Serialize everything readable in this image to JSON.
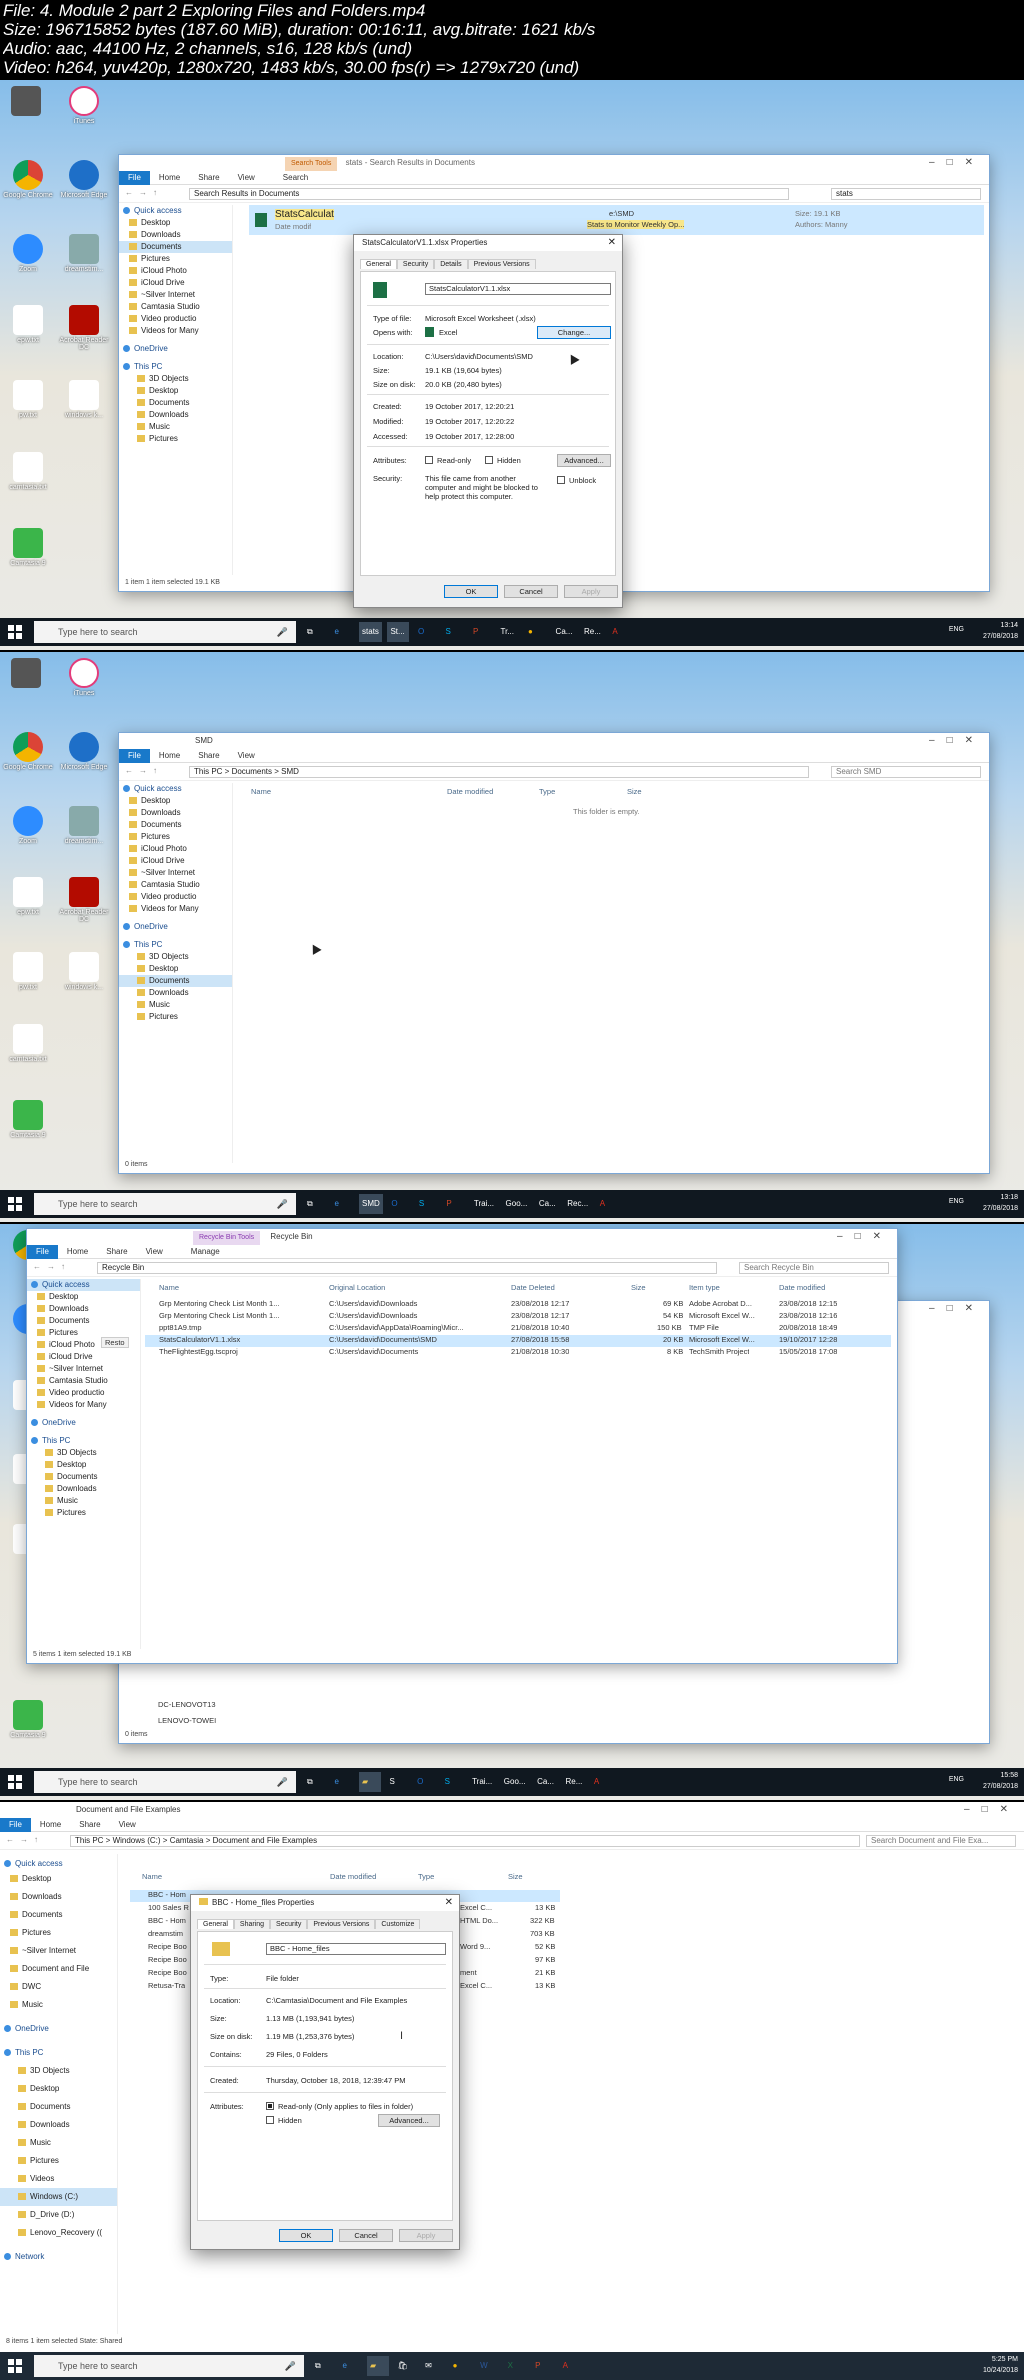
{
  "header": {
    "line1": "File: 4. Module 2 part 2 Exploring Files and Folders.mp4",
    "line2": "Size: 196715852 bytes (187.60 MiB), duration: 00:16:11, avg.bitrate: 1621 kb/s",
    "line3": "Audio: aac, 44100 Hz, 2 channels, s16, 128 kb/s (und)",
    "line4": "Video: h264, yuv420p, 1280x720, 1483 kb/s, 30.00 fps(r) => 1279x720 (und)"
  },
  "desktop_icons": [
    "iTunes",
    "Google Chrome",
    "Microsoft Edge",
    "Zoom",
    "dreamstim...",
    "epw.txt",
    "Acrobat Reader DC",
    "pw.txt",
    "windows k...",
    "camtasia.txt",
    "Camtasia 9"
  ],
  "frame1": {
    "window_title": "stats - Search Results in Documents",
    "ctx_tab": "Search Tools",
    "ribbon": [
      "File",
      "Home",
      "Share",
      "View",
      "Search"
    ],
    "address": "Search Results in Documents",
    "search_value": "stats",
    "nav": [
      {
        "label": "Quick access",
        "type": "head"
      },
      {
        "label": "Desktop"
      },
      {
        "label": "Downloads"
      },
      {
        "label": "Documents",
        "sel": true
      },
      {
        "label": "Pictures"
      },
      {
        "label": "iCloud Photo"
      },
      {
        "label": "iCloud Drive"
      },
      {
        "label": "~Silver Internet"
      },
      {
        "label": "Camtasia Studio"
      },
      {
        "label": "Video productio"
      },
      {
        "label": "Videos for Many"
      },
      {
        "label": "OneDrive",
        "type": "head"
      },
      {
        "label": "This PC",
        "type": "head"
      },
      {
        "label": "3D Objects"
      },
      {
        "label": "Desktop"
      },
      {
        "label": "Documents"
      },
      {
        "label": "Downloads"
      },
      {
        "label": "Music"
      },
      {
        "label": "Pictures"
      }
    ],
    "result_name": "StatsCalculat",
    "result_sub": "Date modif",
    "result_right1": "e:\\SMD",
    "result_right2": "Stats to Monitor Weekly Op...",
    "result_size": "Size: 19.1 KB",
    "result_authors": "Authors: Manny",
    "status": "1 item    1 item selected  19.1 KB",
    "dialog": {
      "title": "StatsCalculatorV1.1.xlsx Properties",
      "tabs": [
        "General",
        "Security",
        "Details",
        "Previous Versions"
      ],
      "filename": "StatsCalculatorV1.1.xlsx",
      "type_label": "Type of file:",
      "type_value": "Microsoft Excel Worksheet (.xlsx)",
      "opens_label": "Opens with:",
      "opens_value": "Excel",
      "change_label": "Change...",
      "location_label": "Location:",
      "location_value": "C:\\Users\\david\\Documents\\SMD",
      "size_label": "Size:",
      "size_value": "19.1 KB (19,604 bytes)",
      "disk_label": "Size on disk:",
      "disk_value": "20.0 KB (20,480 bytes)",
      "created_label": "Created:",
      "created_value": "19 October 2017, 12:20:21",
      "modified_label": "Modified:",
      "modified_value": "19 October 2017, 12:20:22",
      "accessed_label": "Accessed:",
      "accessed_value": "19 October 2017, 12:28:00",
      "attributes_label": "Attributes:",
      "readonly_label": "Read-only",
      "hidden_label": "Hidden",
      "advanced_label": "Advanced...",
      "security_label": "Security:",
      "security_text1": "This file came from another",
      "security_text2": "computer and might be blocked to",
      "security_text3": "help protect this computer.",
      "unblock_label": "Unblock",
      "ok_label": "OK",
      "cancel_label": "Cancel",
      "apply_label": "Apply"
    },
    "time": "13:14",
    "date": "27/08/2018",
    "lang": "ENG",
    "task_apps": [
      "stats",
      "St...",
      "Tr...",
      "Ca...",
      "Re..."
    ]
  },
  "frame2": {
    "window_title": "SMD",
    "ribbon": [
      "File",
      "Home",
      "Share",
      "View"
    ],
    "address": "This PC  >  Documents  >  SMD",
    "search_placeholder": "Search SMD",
    "columns": [
      "Name",
      "Date modified",
      "Type",
      "Size"
    ],
    "empty_text": "This folder is empty.",
    "nav": [
      {
        "label": "Quick access",
        "type": "head"
      },
      {
        "label": "Desktop"
      },
      {
        "label": "Downloads"
      },
      {
        "label": "Documents"
      },
      {
        "label": "Pictures"
      },
      {
        "label": "iCloud Photo"
      },
      {
        "label": "iCloud Drive"
      },
      {
        "label": "~Silver Internet"
      },
      {
        "label": "Camtasia Studio"
      },
      {
        "label": "Video productio"
      },
      {
        "label": "Videos for Many"
      },
      {
        "label": "OneDrive",
        "type": "head"
      },
      {
        "label": "This PC",
        "type": "head"
      },
      {
        "label": "3D Objects"
      },
      {
        "label": "Desktop"
      },
      {
        "label": "Documents",
        "sel": true
      },
      {
        "label": "Downloads"
      },
      {
        "label": "Music"
      },
      {
        "label": "Pictures"
      }
    ],
    "status": "0 items",
    "time": "13:18",
    "date": "27/08/2018",
    "lang": "ENG",
    "task_apps": [
      "SMD",
      "Trai...",
      "Goo...",
      "Ca...",
      "Rec..."
    ]
  },
  "frame3": {
    "window_title": "Recycle Bin",
    "ctx_tab": "Recycle Bin Tools",
    "ribbon": [
      "File",
      "Home",
      "Share",
      "View",
      "Manage"
    ],
    "address": "Recycle Bin",
    "search_placeholder": "Search Recycle Bin",
    "columns": [
      "Name",
      "Original Location",
      "Date Deleted",
      "Size",
      "Item type",
      "Date modified"
    ],
    "rows": [
      {
        "name": "Grp Mentoring Check List Month 1...",
        "loc": "C:\\Users\\david\\Downloads",
        "deleted": "23/08/2018 12:17",
        "size": "69 KB",
        "type": "Adobe Acrobat D...",
        "modified": "23/08/2018 12:15"
      },
      {
        "name": "Grp Mentoring Check List Month 1...",
        "loc": "C:\\Users\\david\\Downloads",
        "deleted": "23/08/2018 12:17",
        "size": "54 KB",
        "type": "Microsoft Excel W...",
        "modified": "23/08/2018 12:16"
      },
      {
        "name": "ppt81A9.tmp",
        "loc": "C:\\Users\\david\\AppData\\Roaming\\Micr...",
        "deleted": "21/08/2018 10:40",
        "size": "150 KB",
        "type": "TMP File",
        "modified": "20/08/2018 18:49"
      },
      {
        "name": "StatsCalculatorV1.1.xlsx",
        "loc": "C:\\Users\\david\\Documents\\SMD",
        "deleted": "27/08/2018 15:58",
        "size": "20 KB",
        "type": "Microsoft Excel W...",
        "modified": "19/10/2017 12:28",
        "sel": true
      },
      {
        "name": "TheFlightestEgg.tscproj",
        "loc": "C:\\Users\\david\\Documents",
        "deleted": "21/08/2018 10:30",
        "size": "8 KB",
        "type": "TechSmith Project",
        "modified": "15/05/2018 17:08"
      }
    ],
    "context_menu_item": "Resto",
    "nav": [
      {
        "label": "Quick access",
        "type": "head"
      },
      {
        "label": "Desktop"
      },
      {
        "label": "Downloads"
      },
      {
        "label": "Documents"
      },
      {
        "label": "Pictures"
      },
      {
        "label": "iCloud Photo"
      },
      {
        "label": "iCloud Drive"
      },
      {
        "label": "~Silver Internet"
      },
      {
        "label": "Camtasia Studio"
      },
      {
        "label": "Video productio"
      },
      {
        "label": "Videos for Many"
      },
      {
        "label": "OneDrive",
        "type": "head"
      },
      {
        "label": "This PC",
        "type": "head"
      },
      {
        "label": "3D Objects"
      },
      {
        "label": "Desktop"
      },
      {
        "label": "Documents"
      },
      {
        "label": "Downloads"
      },
      {
        "label": "Music"
      },
      {
        "label": "Pictures"
      }
    ],
    "status": "5 items    1 item selected  19.1 KB",
    "behind_items": [
      "DC-LENOVOT13",
      "LENOVO-TOWEI"
    ],
    "behind_status": "0 items",
    "time": "15:58",
    "date": "27/08/2018",
    "lang": "ENG",
    "task_apps": [
      "S",
      "Trai...",
      "Goo...",
      "Ca...",
      "Re..."
    ]
  },
  "frame4": {
    "window_title": "Document and File Examples",
    "ribbon": [
      "File",
      "Home",
      "Share",
      "View"
    ],
    "address": "This PC  >  Windows (C:)  >  Camtasia  >  Document and File Examples",
    "search_placeholder": "Search Document and File Exa...",
    "columns": [
      "Name",
      "Date modified",
      "Type",
      "Size"
    ],
    "rows": [
      {
        "name": "BBC - Hom",
        "type": "",
        "size": "",
        "sel": true
      },
      {
        "name": "100 Sales R",
        "type": "Excel C...",
        "size": "13 KB"
      },
      {
        "name": "BBC - Hom",
        "type": "HTML Do...",
        "size": "322 KB"
      },
      {
        "name": "dreamstim",
        "type": "",
        "size": "703 KB"
      },
      {
        "name": "Recipe Boo",
        "type": "Word 9...",
        "size": "52 KB"
      },
      {
        "name": "Recipe Boo",
        "type": "",
        "size": "97 KB"
      },
      {
        "name": "Recipe Boo",
        "type": "ment",
        "size": "21 KB"
      },
      {
        "name": "Retusa-Tra",
        "type": "Excel C...",
        "size": "13 KB"
      }
    ],
    "nav": [
      {
        "label": "Quick access",
        "type": "head"
      },
      {
        "label": "Desktop"
      },
      {
        "label": "Downloads"
      },
      {
        "label": "Documents"
      },
      {
        "label": "Pictures"
      },
      {
        "label": "~Silver Internet"
      },
      {
        "label": "Document and File"
      },
      {
        "label": "DWC"
      },
      {
        "label": "Music"
      },
      {
        "label": "OneDrive",
        "type": "head"
      },
      {
        "label": "This PC",
        "type": "head"
      },
      {
        "label": "3D Objects"
      },
      {
        "label": "Desktop"
      },
      {
        "label": "Documents"
      },
      {
        "label": "Downloads"
      },
      {
        "label": "Music"
      },
      {
        "label": "Pictures"
      },
      {
        "label": "Videos"
      },
      {
        "label": "Windows (C:)",
        "sel": true
      },
      {
        "label": "D_Drive (D:)"
      },
      {
        "label": "Lenovo_Recovery (("
      },
      {
        "label": "Network",
        "type": "head"
      }
    ],
    "dialog": {
      "title": "BBC - Home_files Properties",
      "tabs": [
        "General",
        "Sharing",
        "Security",
        "Previous Versions",
        "Customize"
      ],
      "foldername": "BBC - Home_files",
      "type_label": "Type:",
      "type_value": "File folder",
      "location_label": "Location:",
      "location_value": "C:\\Camtasia\\Document and File Examples",
      "size_label": "Size:",
      "size_value": "1.13 MB (1,193,941 bytes)",
      "disk_label": "Size on disk:",
      "disk_value": "1.19 MB (1,253,376 bytes)",
      "contains_label": "Contains:",
      "contains_value": "29 Files, 0 Folders",
      "created_label": "Created:",
      "created_value": "Thursday, October 18, 2018, 12:39:47 PM",
      "attributes_label": "Attributes:",
      "readonly_label": "Read-only (Only applies to files in folder)",
      "hidden_label": "Hidden",
      "advanced_label": "Advanced...",
      "ok_label": "OK",
      "cancel_label": "Cancel",
      "apply_label": "Apply"
    },
    "status": "8 items    1 item selected    State: Shared",
    "time": "5:25 PM",
    "date": "10/24/2018",
    "search_placeholder_taskbar": "Type here to search"
  },
  "taskbar_search": "Type here to search"
}
